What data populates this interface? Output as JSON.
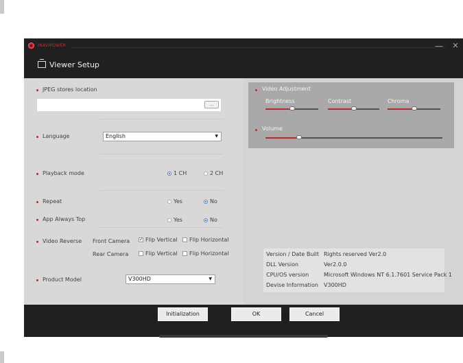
{
  "window": {
    "brand": "INAVIPOWER",
    "title": "Viewer Setup",
    "minimize_glyph": "—",
    "close_glyph": "✕"
  },
  "left": {
    "jpeg": {
      "label": "JPEG stores location",
      "value": "",
      "browse_label": "..."
    },
    "language": {
      "label": "Language",
      "value": "English"
    },
    "playback": {
      "label": "Playback mode",
      "options": [
        "1 CH",
        "2 CH"
      ],
      "selected": "1 CH"
    },
    "repeat": {
      "label": "Repeat",
      "options": [
        "Yes",
        "No"
      ],
      "selected": "No"
    },
    "always_top": {
      "label": "App Always Top",
      "options": [
        "Yes",
        "No"
      ],
      "selected": "No"
    },
    "video_reverse": {
      "label": "Video Reverse",
      "front_label": "Front Camera",
      "rear_label": "Rear Camera",
      "flip_vertical": "Flip Vertical",
      "flip_horizontal": "Flip Horizontal",
      "front_flip_vertical": true,
      "front_flip_horizontal": false,
      "rear_flip_vertical": false,
      "rear_flip_horizontal": false
    },
    "product": {
      "label": "Product Model",
      "value": "V300HD"
    }
  },
  "right": {
    "video_adjustment": {
      "label": "Video Adjustment",
      "brightness": {
        "label": "Brightness",
        "level": 0.5
      },
      "contrast": {
        "label": "Contrast",
        "level": 0.5
      },
      "chroma": {
        "label": "Chroma",
        "level": 0.5
      }
    },
    "volume": {
      "label": "Volume",
      "level": 0.18
    },
    "info": {
      "rows": [
        {
          "key": "Version / Date Built",
          "value": "Rights reserved Ver2.0"
        },
        {
          "key": "DLL Version",
          "value": "Ver2.0.0"
        },
        {
          "key": "CPU/OS version",
          "value": "Microsoft Windows NT 6.1.7601 Service Pack 1"
        },
        {
          "key": "Devise Information",
          "value": "V300HD"
        }
      ]
    }
  },
  "footer": {
    "initialization_label": "Initialization",
    "ok_label": "OK",
    "cancel_label": "Cancel"
  },
  "icons": {
    "logo": "brand-logo-icon",
    "header": "window-icon",
    "dropdown": "chevron-down-icon"
  },
  "colors": {
    "accent": "#d32020",
    "chrome": "#202020",
    "panel_left": "#d8d8d8",
    "panel_right": "#d4d4d4"
  }
}
